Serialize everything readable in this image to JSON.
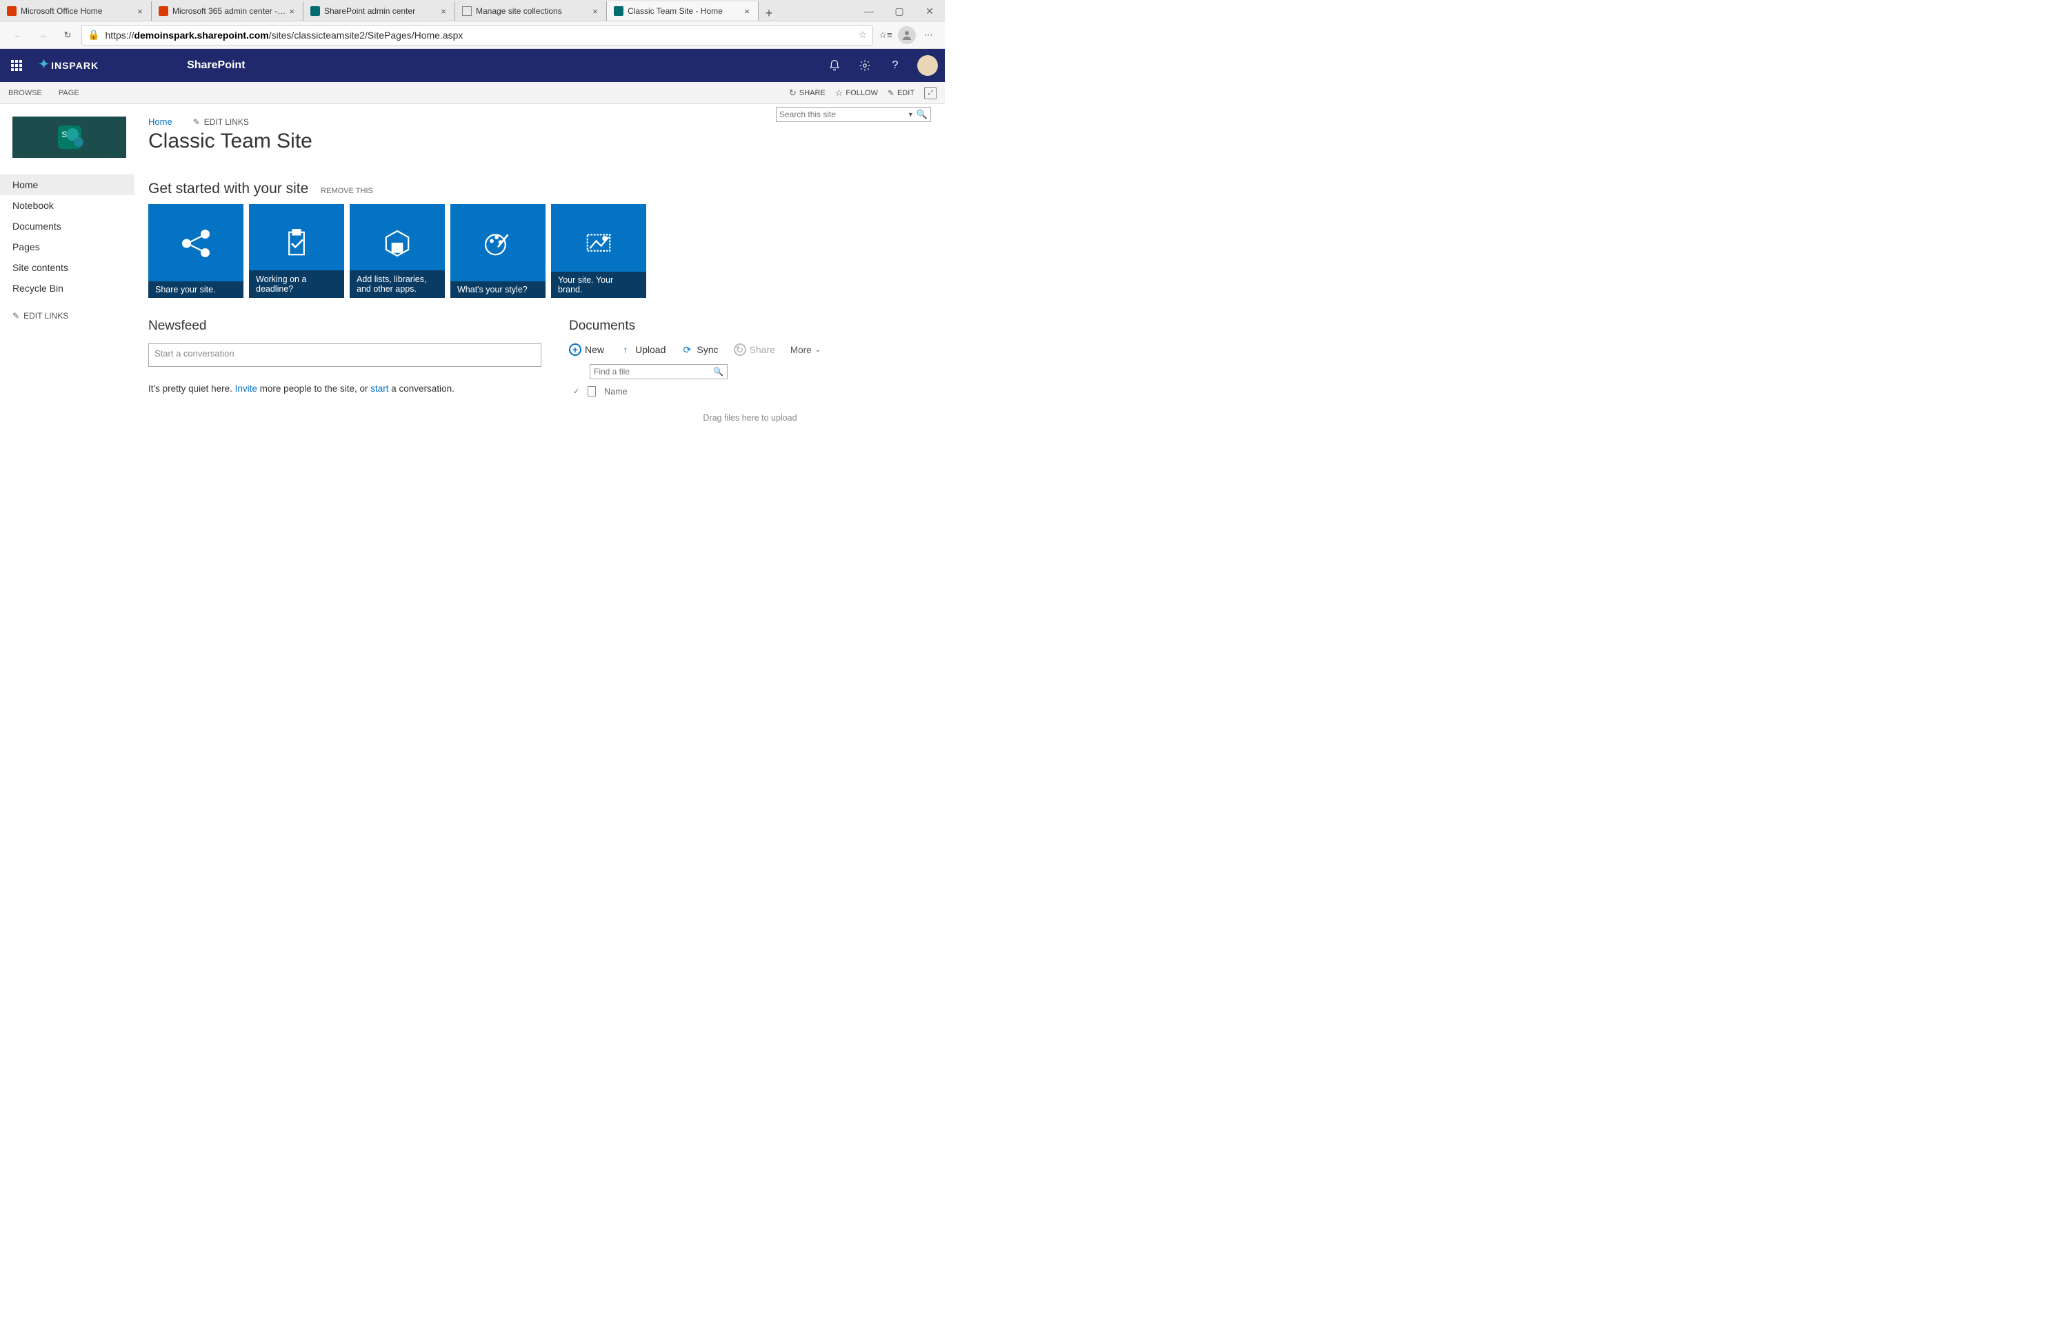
{
  "browser": {
    "tabs": [
      {
        "title": "Microsoft Office Home",
        "icon_color": "#d83b01"
      },
      {
        "title": "Microsoft 365 admin center - M…",
        "icon_color": "#d83b01"
      },
      {
        "title": "SharePoint admin center",
        "icon_color": "#036c70"
      },
      {
        "title": "Manage site collections",
        "icon_color": "#888"
      },
      {
        "title": "Classic Team Site - Home",
        "icon_color": "#036c70",
        "active": true
      }
    ],
    "url_prefix": "https://",
    "url_host": "demoinspark.sharepoint.com",
    "url_path": "/sites/classicteamsite2/SitePages/Home.aspx"
  },
  "suite": {
    "tenant": "INSPARK",
    "product": "SharePoint"
  },
  "ribbon": {
    "browse": "BROWSE",
    "page": "PAGE",
    "share": "SHARE",
    "follow": "FOLLOW",
    "edit": "EDIT"
  },
  "breadcrumb": {
    "home": "Home",
    "edit_links": "EDIT LINKS"
  },
  "site_title": "Classic Team Site",
  "left_nav": {
    "items": [
      "Home",
      "Notebook",
      "Documents",
      "Pages",
      "Site contents",
      "Recycle Bin"
    ],
    "edit_links": "EDIT LINKS"
  },
  "search": {
    "placeholder": "Search this site"
  },
  "get_started": {
    "heading": "Get started with your site",
    "remove": "REMOVE THIS",
    "tiles": [
      "Share your site.",
      "Working on a deadline?",
      "Add lists, libraries, and other apps.",
      "What's your style?",
      "Your site. Your brand."
    ]
  },
  "newsfeed": {
    "heading": "Newsfeed",
    "placeholder": "Start a conversation",
    "quiet_pre": "It's pretty quiet here. ",
    "invite": "Invite",
    "quiet_mid": " more people to the site, or ",
    "start": "start",
    "quiet_post": " a conversation."
  },
  "documents": {
    "heading": "Documents",
    "new": "New",
    "upload": "Upload",
    "sync": "Sync",
    "share": "Share",
    "more": "More",
    "find_placeholder": "Find a file",
    "name_col": "Name",
    "drag": "Drag files here to upload"
  }
}
